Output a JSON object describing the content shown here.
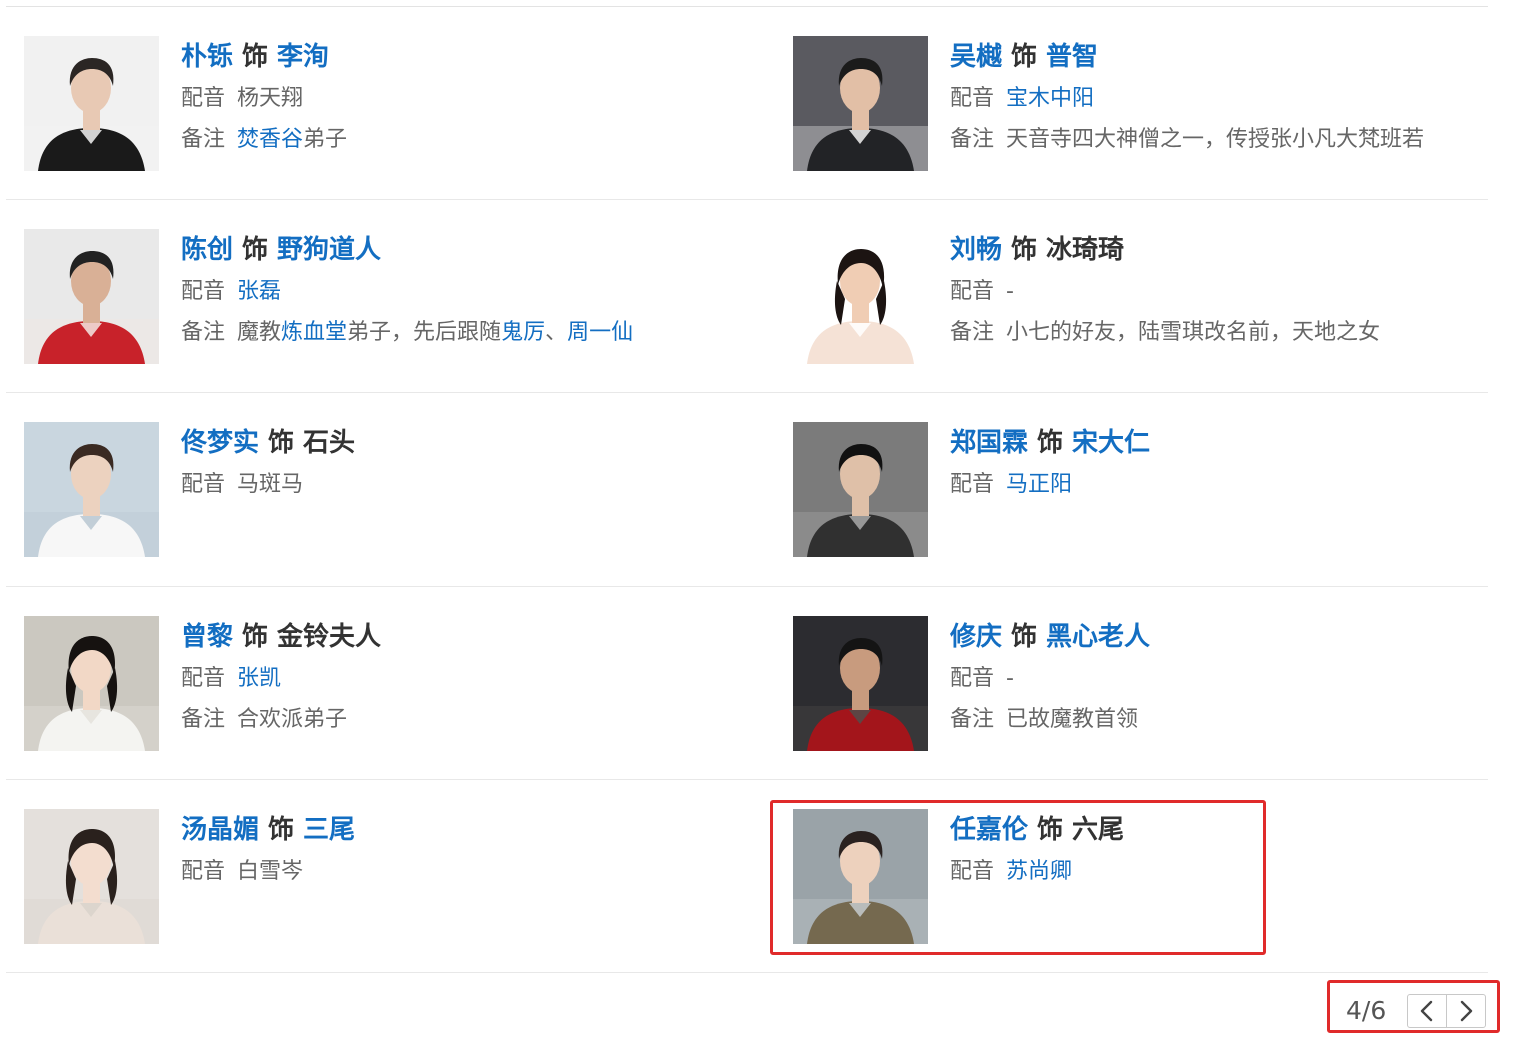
{
  "shi_label": "饰",
  "dub_label": "配音",
  "note_label": "备注",
  "cast": [
    {
      "actor": "朴铄",
      "role": "李洵",
      "role_is_link": true,
      "dub": "杨天翔",
      "dub_is_link": false,
      "note": [
        {
          "text": "焚香谷",
          "link": true
        },
        {
          "text": "弟子",
          "link": false
        }
      ],
      "avatar_icon": "actor-portrait"
    },
    {
      "actor": "吴樾",
      "role": "普智",
      "role_is_link": true,
      "dub": "宝木中阳",
      "dub_is_link": true,
      "note": [
        {
          "text": "天音寺四大神僧之一，传授张小凡大梵班若",
          "link": false
        }
      ],
      "avatar_icon": "actor-portrait"
    },
    {
      "actor": "陈创",
      "role": "野狗道人",
      "role_is_link": true,
      "dub": "张磊",
      "dub_is_link": true,
      "note": [
        {
          "text": "魔教",
          "link": false
        },
        {
          "text": "炼血堂",
          "link": true
        },
        {
          "text": "弟子，先后跟随",
          "link": false
        },
        {
          "text": "鬼厉",
          "link": true
        },
        {
          "text": "、",
          "link": false
        },
        {
          "text": "周一仙",
          "link": true
        }
      ],
      "avatar_icon": "actor-portrait"
    },
    {
      "actor": "刘畅",
      "role": "冰琦琦",
      "role_is_link": false,
      "dub": "-",
      "dub_is_link": false,
      "note": [
        {
          "text": "小七的好友，陆雪琪改名前，天地之女",
          "link": false
        }
      ],
      "avatar_icon": "actress-portrait"
    },
    {
      "actor": "佟梦实",
      "role": "石头",
      "role_is_link": false,
      "dub": "马斑马",
      "dub_is_link": false,
      "note": [],
      "avatar_icon": "actor-portrait"
    },
    {
      "actor": "郑国霖",
      "role": "宋大仁",
      "role_is_link": true,
      "dub": "马正阳",
      "dub_is_link": true,
      "note": [],
      "avatar_icon": "actor-portrait"
    },
    {
      "actor": "曾黎",
      "role": "金铃夫人",
      "role_is_link": false,
      "dub": "张凯",
      "dub_is_link": true,
      "note": [
        {
          "text": "合欢派弟子",
          "link": false
        }
      ],
      "avatar_icon": "actress-portrait"
    },
    {
      "actor": "修庆",
      "role": "黑心老人",
      "role_is_link": true,
      "dub": "-",
      "dub_is_link": false,
      "note": [
        {
          "text": "已故魔教首领",
          "link": false
        }
      ],
      "avatar_icon": "actor-portrait"
    },
    {
      "actor": "汤晶媚",
      "role": "三尾",
      "role_is_link": true,
      "dub": "白雪岑",
      "dub_is_link": false,
      "note": [],
      "avatar_icon": "actress-portrait"
    },
    {
      "actor": "任嘉伦",
      "role": "六尾",
      "role_is_link": false,
      "dub": "苏尚卿",
      "dub_is_link": true,
      "note": [],
      "avatar_icon": "actor-portrait"
    }
  ],
  "pagination": {
    "indicator": "4/6",
    "prev_icon": "chevron-left-icon",
    "next_icon": "chevron-right-icon"
  },
  "colors": {
    "link": "#136ec2",
    "highlight_border": "#e02a2a"
  }
}
